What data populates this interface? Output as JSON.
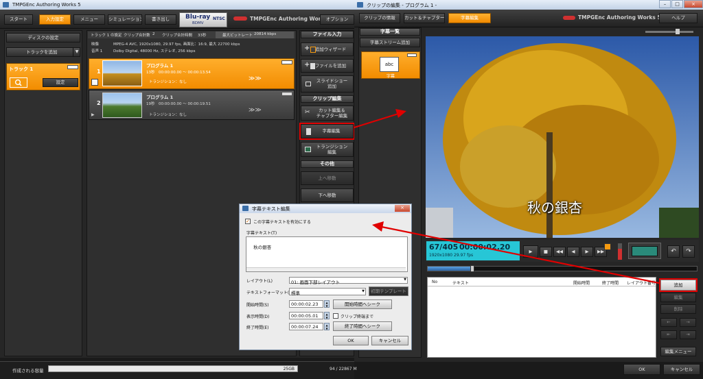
{
  "main_window": {
    "title": "TMPGEnc Authoring Works 5",
    "tabs": [
      "スタート",
      "入力設定",
      "メニュー",
      "シミュレーション",
      "書き出し"
    ],
    "format_badge": {
      "line1": "Blu-ray",
      "line2": "BDMV",
      "tv": "NTSC"
    },
    "brand": "TMPGEnc Authoring Works 5",
    "options_label": "オプション"
  },
  "left_panel": {
    "disc_settings": "ディスクの設定",
    "add_track": "トラックを追加",
    "track_label": "トラック 1",
    "settings_button": "設定"
  },
  "track_info": {
    "row1_a": "トラック 1 の設定",
    "row1_b": "クリップ合計数",
    "row1_c": "2",
    "row1_d": "クリップ合計時間",
    "row1_e": "33秒",
    "row1_f": "最大ビットレート",
    "row1_g": "20814 kbps",
    "video_label": "映像",
    "video_value": "MPEG-4 AVC,  1920x1080,  29.97 fps,  画面比：16:9,  最大 22700 kbps",
    "audio_label": "音声 1",
    "audio_value": "Dolby Digital,  48000 Hz,  ステレオ,  256 kbps"
  },
  "clips": [
    {
      "index": "1",
      "name": "プログラム 1",
      "duration": "13秒",
      "range": "00:00:00.00 ～ 00:00:13.54",
      "transition": "トランジション：なし"
    },
    {
      "index": "2",
      "name": "プログラム 1",
      "duration": "19秒",
      "range": "00:00:00.00 ～ 00:00:19.51",
      "transition": "トランジション：なし"
    }
  ],
  "file_input": {
    "header": "ファイル入力",
    "add_wizard": "追加ウィザード",
    "add_file": "ファイルを追加",
    "slideshow": [
      "スライドショー",
      "追加"
    ],
    "clip_edit_header": "クリップ編集",
    "cut_edit": [
      "カット編集＆",
      "チャプター編集"
    ],
    "subtitle_edit": "字幕編集",
    "transition_edit": [
      "トランジション",
      "編集"
    ],
    "other_header": "その他",
    "move_up": "上へ移動",
    "move_down": "下へ移動"
  },
  "status_bar": {
    "capacity_label": "作成される容量",
    "capacity_value": "25GB",
    "remaining": "94 / 22867 M"
  },
  "clip_editor": {
    "title": "クリップの編集 - プログラム 1 -",
    "tabs": [
      "クリップの情報",
      "カット＆チャプター",
      "字幕編集"
    ],
    "brand": "TMPGEnc Authoring Works 5",
    "help": "ヘルプ",
    "subtitle_list_header": "字幕一覧",
    "add_stream": "字幕ストリーム追加",
    "stream_item_label": "字幕",
    "stream_icon_text": "abc",
    "preview_overlay": "秋の銀杏",
    "frame_counter": "67/405",
    "timecode": "00:00:02.20",
    "video_spec": "1920x1080 29.97 fps",
    "table_columns": [
      "No",
      "テキスト",
      "開始時間",
      "終了時間",
      "レイアウト番号"
    ],
    "side_buttons": [
      "追加",
      "編集",
      "削除"
    ],
    "edit_menu": "編集メニュー",
    "ok": "OK",
    "cancel": "キャンセル"
  },
  "subtitle_dialog": {
    "title": "字幕テキスト編集",
    "enable_checkbox": "この字幕テキストを有効にする",
    "text_label": "字幕テキスト(T)",
    "text_value": "秋の銀杏",
    "layout_label": "レイアウト(L)",
    "layout_value": "01: 画面下部レイアウト",
    "format_label": "テキストフォーマット(F)",
    "format_value": "標準",
    "template_button": "初期テンプレート",
    "start_label": "開始時間(S)",
    "start_value": "00:00:02.23",
    "start_seek": "開始時間へシーク",
    "display_label": "表示時間(D)",
    "display_value": "00:00:05.01",
    "until_clip_end": "クリップ終端まで",
    "end_label": "終了時間(E)",
    "end_value": "00:00:07.24",
    "end_seek": "終了時間へシーク",
    "ok": "OK",
    "cancel": "キャンセル"
  },
  "colors": {
    "accent": "#f59a10",
    "highlight_red": "#e00000",
    "timecode_bg": "#27c6d6"
  }
}
